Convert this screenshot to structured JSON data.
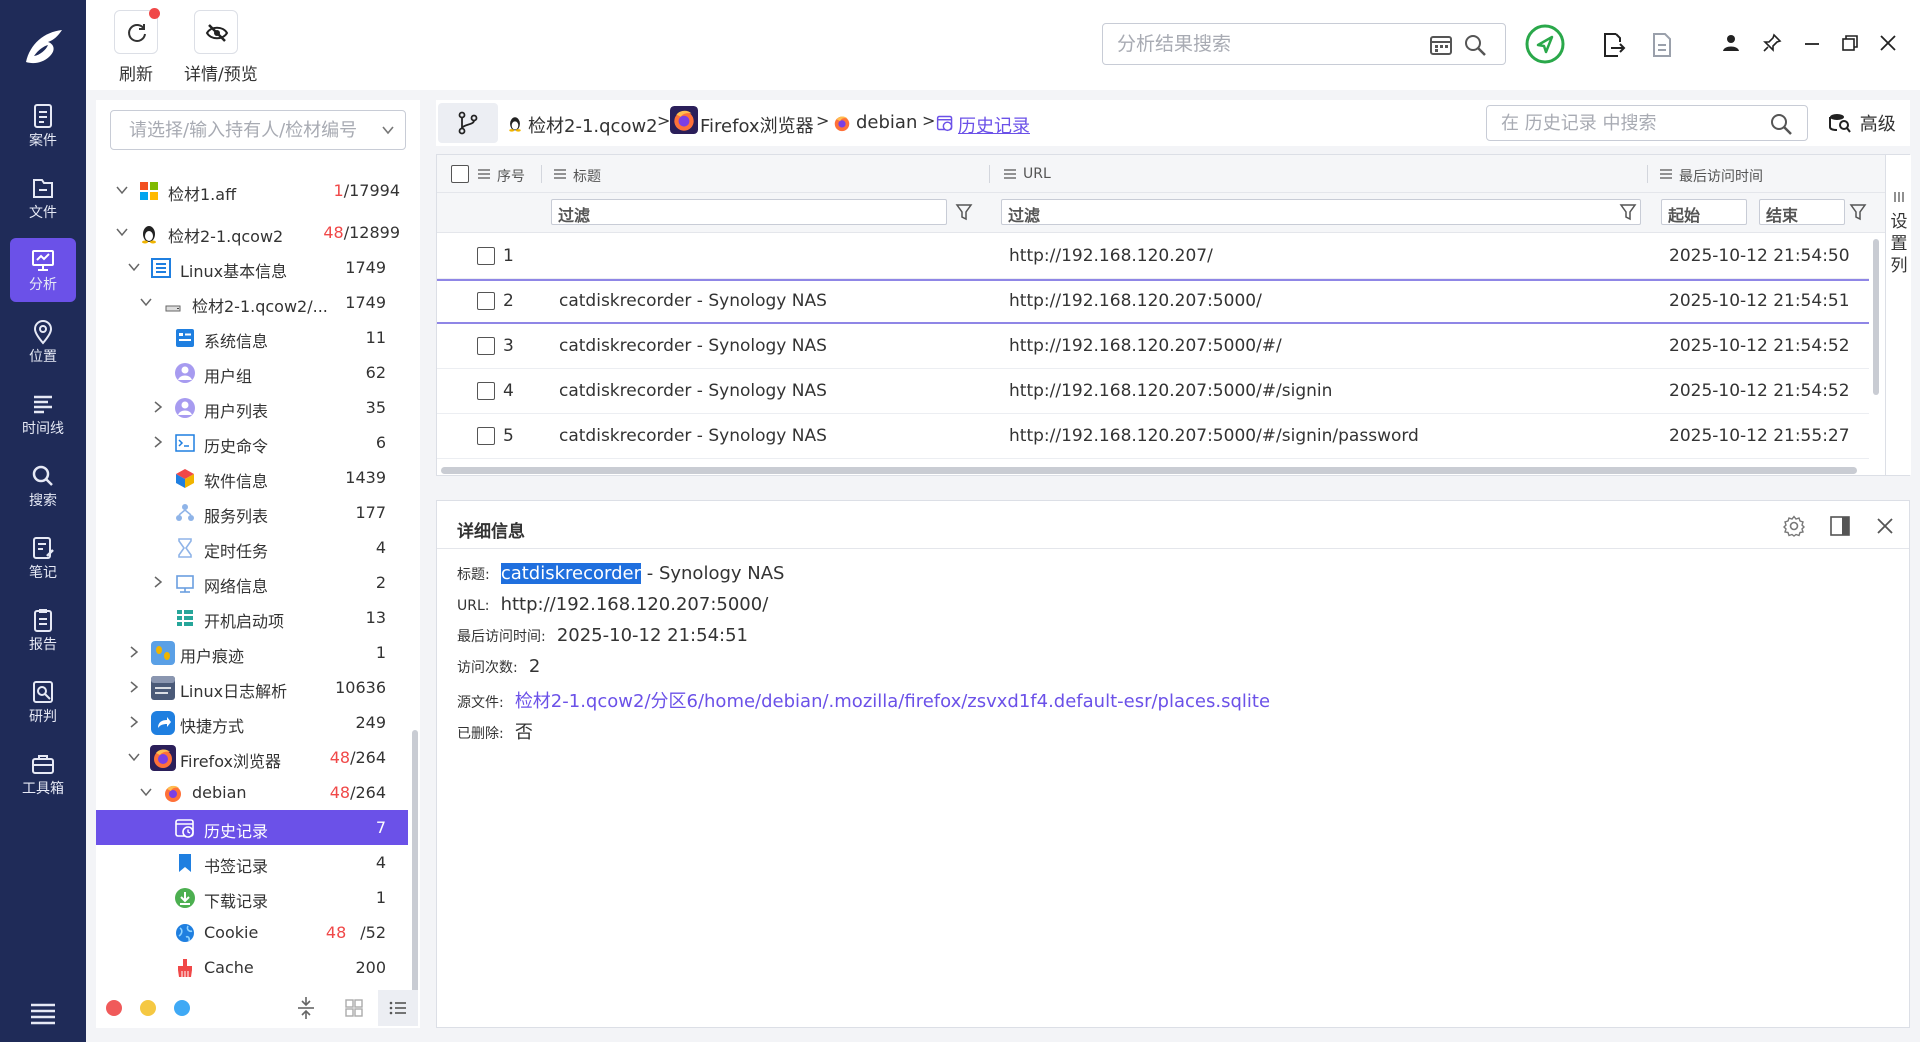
{
  "nav": {
    "items": [
      {
        "label": "案件",
        "icon": "case-icon"
      },
      {
        "label": "文件",
        "icon": "folder-icon"
      },
      {
        "label": "分析",
        "icon": "analysis-icon"
      },
      {
        "label": "位置",
        "icon": "location-icon"
      },
      {
        "label": "时间线",
        "icon": "timeline-icon"
      },
      {
        "label": "搜索",
        "icon": "search-icon"
      },
      {
        "label": "笔记",
        "icon": "note-icon"
      },
      {
        "label": "报告",
        "icon": "report-icon"
      },
      {
        "label": "研判",
        "icon": "judge-icon"
      },
      {
        "label": "工具箱",
        "icon": "toolbox-icon"
      }
    ],
    "active_color": "#6b51e8",
    "bg_color": "#1f2b58"
  },
  "toolbar": {
    "refresh_label": "刷新",
    "preview_label": "详情/预览",
    "search_placeholder": "分析结果搜索"
  },
  "tree": {
    "select_placeholder": "请选择/输入持有人/检材编号",
    "rows": [
      {
        "label": "检材1.aff",
        "count_red": "1",
        "count": "/17994"
      },
      {
        "label": "检材2-1.qcow2",
        "count_red": "48",
        "count": "/12899"
      },
      {
        "label": "Linux基本信息",
        "count_red": "",
        "count": "1749"
      },
      {
        "label": "检材2-1.qcow2/...",
        "count_red": "",
        "count": "1749"
      },
      {
        "label": "系统信息",
        "count_red": "",
        "count": "11"
      },
      {
        "label": "用户组",
        "count_red": "",
        "count": "62"
      },
      {
        "label": "用户列表",
        "count_red": "",
        "count": "35"
      },
      {
        "label": "历史命令",
        "count_red": "",
        "count": "6"
      },
      {
        "label": "软件信息",
        "count_red": "",
        "count": "1439"
      },
      {
        "label": "服务列表",
        "count_red": "",
        "count": "177"
      },
      {
        "label": "定时任务",
        "count_red": "",
        "count": "4"
      },
      {
        "label": "网络信息",
        "count_red": "",
        "count": "2"
      },
      {
        "label": "开机启动项",
        "count_red": "",
        "count": "13"
      },
      {
        "label": "用户痕迹",
        "count_red": "",
        "count": "1"
      },
      {
        "label": "Linux日志解析",
        "count_red": "",
        "count": "10636"
      },
      {
        "label": "快捷方式",
        "count_red": "",
        "count": "249"
      },
      {
        "label": "Firefox浏览器",
        "count_red": "48",
        "count": "/264"
      },
      {
        "label": "debian",
        "count_red": "48",
        "count": "/264"
      },
      {
        "label": "历史记录",
        "count_red": "",
        "count": "7"
      },
      {
        "label": "书签记录",
        "count_red": "",
        "count": "4"
      },
      {
        "label": "下载记录",
        "count_red": "",
        "count": "1"
      },
      {
        "label": "Cookie",
        "count_red": "48",
        "count": "/52"
      },
      {
        "label": "Cache",
        "count_red": "",
        "count": "200"
      }
    ]
  },
  "breadcrumb": {
    "items": [
      "检材2-1.qcow2",
      "Firefox浏览器",
      "debian",
      "历史记录"
    ],
    "sep": ">",
    "search_placeholder": "在 历史记录 中搜索",
    "advanced_label": "高级"
  },
  "table": {
    "headers": {
      "index": "序号",
      "title": "标题",
      "url": "URL",
      "last_visit": "最后访问时间"
    },
    "filter_label": "过滤",
    "start_label": "起始",
    "end_label": "结束",
    "column_settings": "设置列",
    "rows": [
      {
        "index": "1",
        "title": "",
        "url": "http://192.168.120.207/",
        "time": "2025-10-12 21:54:50"
      },
      {
        "index": "2",
        "title": "catdiskrecorder - Synology NAS",
        "url": "http://192.168.120.207:5000/",
        "time": "2025-10-12 21:54:51"
      },
      {
        "index": "3",
        "title": "catdiskrecorder - Synology NAS",
        "url": "http://192.168.120.207:5000/#/",
        "time": "2025-10-12 21:54:52"
      },
      {
        "index": "4",
        "title": "catdiskrecorder - Synology NAS",
        "url": "http://192.168.120.207:5000/#/signin",
        "time": "2025-10-12 21:54:52"
      },
      {
        "index": "5",
        "title": "catdiskrecorder - Synology NAS",
        "url": "http://192.168.120.207:5000/#/signin/password",
        "time": "2025-10-12 21:55:27"
      }
    ]
  },
  "detail": {
    "title": "详细信息",
    "fields": {
      "title_key": "标题:",
      "title_highlight": "catdiskrecorder",
      "title_rest": " - Synology NAS",
      "url_key": "URL:",
      "url_val": "http://192.168.120.207:5000/",
      "time_key": "最后访问时间:",
      "time_val": "2025-10-12 21:54:51",
      "visits_key": "访问次数:",
      "visits_val": "2",
      "source_key": "源文件:",
      "source_val": "检材2-1.qcow2/分区6/home/debian/.mozilla/firefox/zsvxd1f4.default-esr/places.sqlite",
      "deleted_key": "已删除:",
      "deleted_val": "否"
    }
  }
}
